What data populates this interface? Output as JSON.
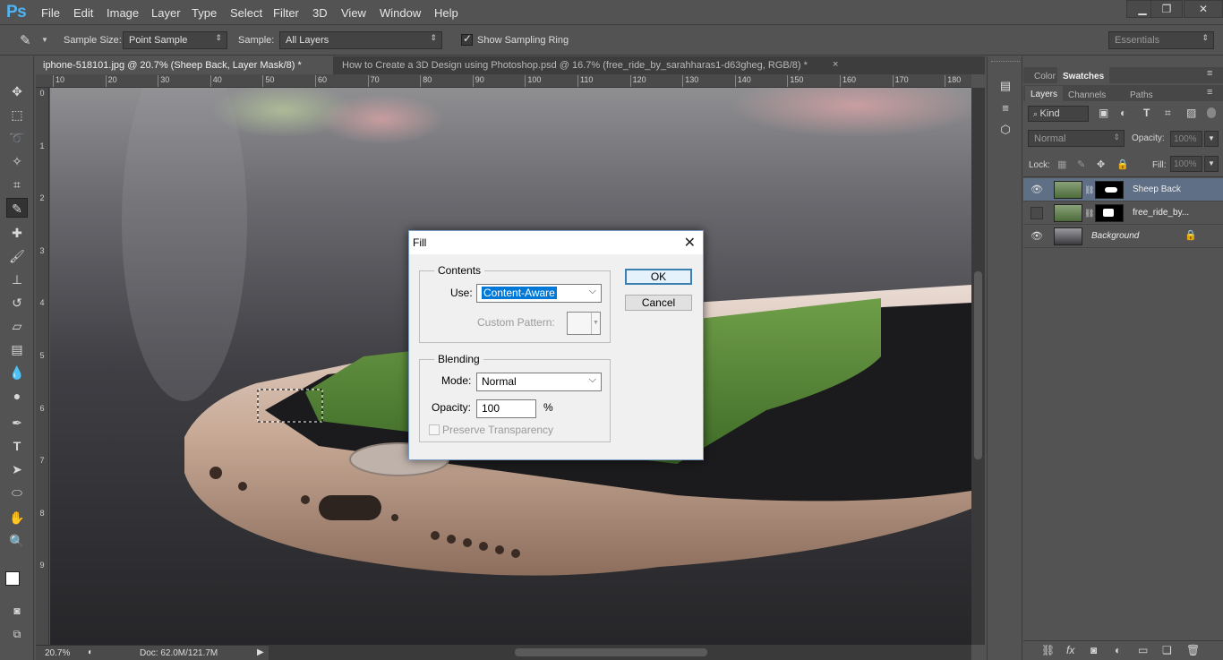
{
  "app": {
    "logo": "Ps",
    "menu": [
      "File",
      "Edit",
      "Image",
      "Layer",
      "Type",
      "Select",
      "Filter",
      "3D",
      "View",
      "Window",
      "Help"
    ]
  },
  "options": {
    "sample_size_label": "Sample Size:",
    "sample_size_value": "Point Sample",
    "sample_label": "Sample:",
    "sample_value": "All Layers",
    "show_sampling_ring": "Show Sampling Ring",
    "workspace": "Essentials"
  },
  "tabs": [
    {
      "label": "iphone-518101.jpg @ 20.7% (Sheep Back, Layer Mask/8) *"
    },
    {
      "label": "How to Create a 3D Design using Photoshop.psd @ 16.7% (free_ride_by_sarahharas1-d63gheg, RGB/8) *"
    }
  ],
  "ruler": {
    "top": [
      "10",
      "20",
      "30",
      "40",
      "50",
      "60",
      "70",
      "80",
      "90",
      "100",
      "110",
      "120",
      "130",
      "140",
      "150",
      "160",
      "170",
      "180"
    ],
    "left": [
      "0",
      "1",
      "2",
      "3",
      "4",
      "5",
      "6",
      "7",
      "8",
      "9"
    ]
  },
  "status": {
    "zoom": "20.7%",
    "doc": "Doc: 62.0M/121.7M"
  },
  "panels": {
    "top_tabs": [
      "Color",
      "Swatches"
    ],
    "layer_tabs": [
      "Layers",
      "Channels",
      "Paths"
    ],
    "kind_label": "Kind",
    "blend_mode": "Normal",
    "opacity_label": "Opacity:",
    "opacity_value": "100%",
    "lock_label": "Lock:",
    "fill_label": "Fill:",
    "fill_value": "100%",
    "layers": [
      {
        "name": "Sheep Back"
      },
      {
        "name": "free_ride_by..."
      },
      {
        "name": "Background"
      }
    ]
  },
  "dialog": {
    "title": "Fill",
    "contents_label": "Contents",
    "use_label": "Use:",
    "use_value": "Content-Aware",
    "custom_pattern_label": "Custom Pattern:",
    "blending_label": "Blending",
    "mode_label": "Mode:",
    "mode_value": "Normal",
    "opacity_label": "Opacity:",
    "opacity_value": "100",
    "opacity_unit": "%",
    "preserve_label": "Preserve Transparency",
    "ok": "OK",
    "cancel": "Cancel"
  },
  "colors": {
    "accent": "#3c7fb1",
    "ps_blue": "#4fb3f4",
    "selected_layer": "#5f6f86"
  }
}
